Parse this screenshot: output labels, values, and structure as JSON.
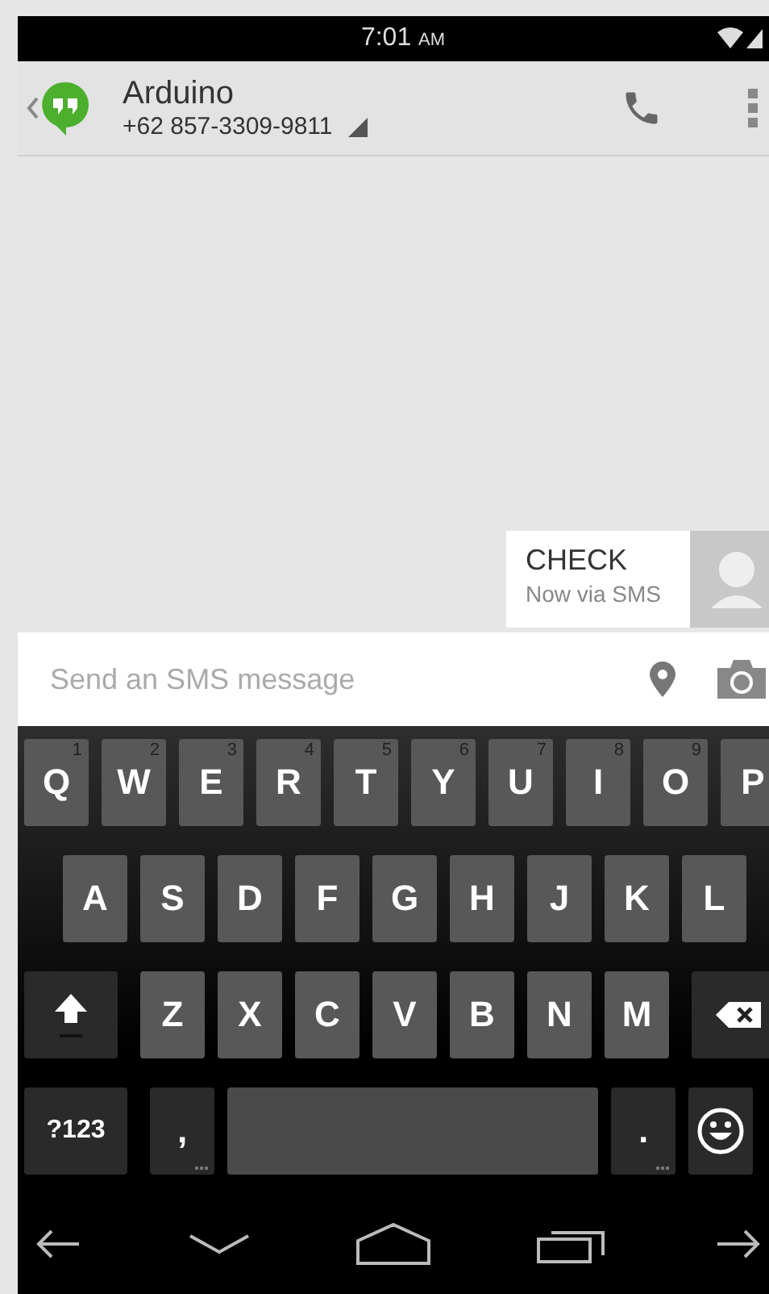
{
  "status_bar": {
    "time": "7:01",
    "meridiem": "AM"
  },
  "header": {
    "name": "Arduino",
    "number": "+62 857-3309-9811"
  },
  "messages": [
    {
      "text": "CHECK",
      "status": "Now via SMS",
      "kind": "outgoing"
    }
  ],
  "compose": {
    "placeholder": "Send an SMS message"
  },
  "keyboard": {
    "rows": [
      {
        "keys": [
          {
            "kind": "letter",
            "label": "Q",
            "hint": "1"
          },
          {
            "kind": "letter",
            "label": "W",
            "hint": "2"
          },
          {
            "kind": "letter",
            "label": "E",
            "hint": "3"
          },
          {
            "kind": "letter",
            "label": "R",
            "hint": "4"
          },
          {
            "kind": "letter",
            "label": "T",
            "hint": "5"
          },
          {
            "kind": "letter",
            "label": "Y",
            "hint": "6"
          },
          {
            "kind": "letter",
            "label": "U",
            "hint": "7"
          },
          {
            "kind": "letter",
            "label": "I",
            "hint": "8"
          },
          {
            "kind": "letter",
            "label": "O",
            "hint": "9"
          },
          {
            "kind": "letter",
            "label": "P"
          }
        ]
      },
      {
        "keys": [
          {
            "kind": "letter",
            "label": "A"
          },
          {
            "kind": "letter",
            "label": "S"
          },
          {
            "kind": "letter",
            "label": "D"
          },
          {
            "kind": "letter",
            "label": "F"
          },
          {
            "kind": "letter",
            "label": "G"
          },
          {
            "kind": "letter",
            "label": "H"
          },
          {
            "kind": "letter",
            "label": "J"
          },
          {
            "kind": "letter",
            "label": "K"
          },
          {
            "kind": "letter",
            "label": "L"
          }
        ]
      },
      {
        "keys": [
          {
            "kind": "shift"
          },
          {
            "kind": "letter",
            "label": "Z"
          },
          {
            "kind": "letter",
            "label": "X"
          },
          {
            "kind": "letter",
            "label": "C"
          },
          {
            "kind": "letter",
            "label": "V"
          },
          {
            "kind": "letter",
            "label": "B"
          },
          {
            "kind": "letter",
            "label": "N"
          },
          {
            "kind": "letter",
            "label": "M"
          },
          {
            "kind": "backspace"
          }
        ]
      },
      {
        "keys": [
          {
            "kind": "symbols",
            "label": "?123"
          },
          {
            "kind": "punct",
            "label": ","
          },
          {
            "kind": "space"
          },
          {
            "kind": "punct",
            "label": "."
          },
          {
            "kind": "emoji"
          }
        ]
      }
    ]
  }
}
